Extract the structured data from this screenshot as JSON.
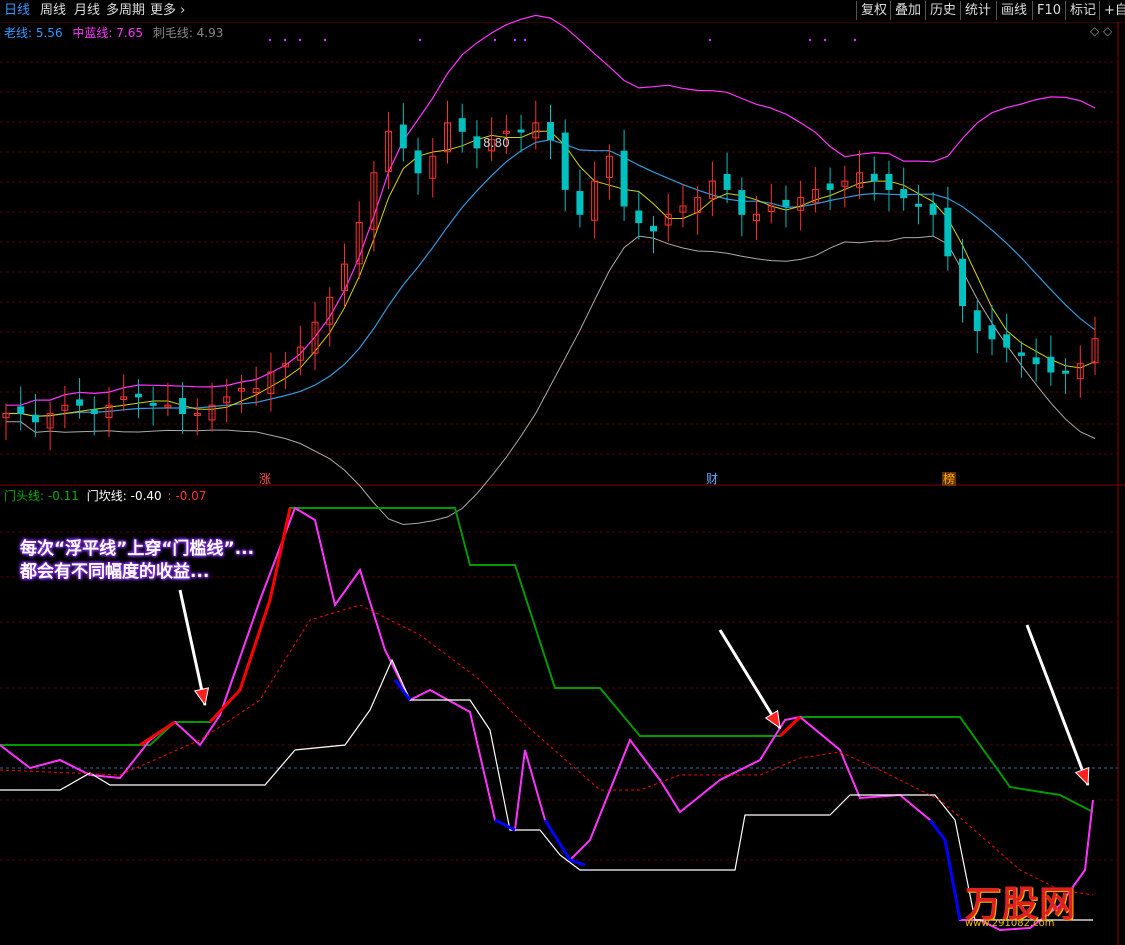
{
  "toolbar": {
    "tabs": [
      "日线",
      "周线",
      "月线",
      "多周期",
      "更多"
    ],
    "right_buttons": [
      "复权",
      "叠加",
      "历史",
      "统计",
      "画线",
      "F10",
      "标记",
      "+自"
    ]
  },
  "top_legend": {
    "lao": "老线: 5.56",
    "mid": "中蓝线: 7.65",
    "cimao": "刺毛线: 4.93"
  },
  "bottom_legend": {
    "mentou": "门头线: -0.11",
    "menkan": "门坎线: -0.40",
    "diff": ": -0.07"
  },
  "price_label": "8.80",
  "markers": [
    "涨",
    "财",
    "榜"
  ],
  "annotation": {
    "line1": "每次“浮平线”上穿“门槛线”...",
    "line2": "都会有不同幅度的收益..."
  },
  "watermark": {
    "main": "万股网",
    "sub": "www.291082.com"
  },
  "colors": {
    "up": "#ff3030",
    "down": "#00c0c0",
    "pink": "#ff33ff",
    "blue_ma": "#3399dd",
    "green": "#009900",
    "white": "#ffffff",
    "red_line": "#ff0000",
    "blue_line": "#0000ff"
  },
  "chart_data": [
    {
      "type": "candlestick",
      "title": "",
      "series": [
        {
          "name": "老线",
          "values": []
        },
        {
          "name": "中蓝线",
          "values": []
        },
        {
          "name": "刺毛线",
          "values": []
        }
      ],
      "close_estimate": [
        5.1,
        5.1,
        5.0,
        5.1,
        5.2,
        5.2,
        5.1,
        5.2,
        5.3,
        5.3,
        5.2,
        5.2,
        5.1,
        5.1,
        5.2,
        5.3,
        5.4,
        5.4,
        5.6,
        5.7,
        5.9,
        6.2,
        6.5,
        6.9,
        7.4,
        8.0,
        8.5,
        8.3,
        8.0,
        8.2,
        8.6,
        8.5,
        8.3,
        8.4,
        8.5,
        8.5,
        8.6,
        8.4,
        7.8,
        7.5,
        7.9,
        8.2,
        7.6,
        7.4,
        7.3,
        7.5,
        7.6,
        7.7,
        7.9,
        7.8,
        7.5,
        7.5,
        7.6,
        7.6,
        7.7,
        7.8,
        7.8,
        7.9,
        8.0,
        7.9,
        7.8,
        7.7,
        7.6,
        7.5,
        7.0,
        6.4,
        6.1,
        6.0,
        5.9,
        5.8,
        5.7,
        5.6,
        5.6,
        5.7,
        6.0
      ],
      "annotations": [
        "8.80"
      ]
    },
    {
      "type": "line",
      "title": "",
      "series": [
        {
          "name": "门头线",
          "values": []
        },
        {
          "name": "门坎线",
          "values": []
        }
      ]
    }
  ]
}
